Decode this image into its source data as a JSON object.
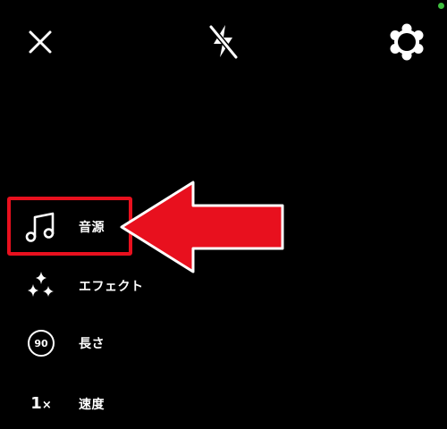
{
  "top_bar": {
    "close_icon": "close-icon",
    "flash_icon": "flash-off-icon",
    "settings_icon": "gear-icon"
  },
  "status_dot_color": "#3fbf3f",
  "menu": {
    "items": [
      {
        "icon": "music-note-icon",
        "label": "音源"
      },
      {
        "icon": "sparkle-icon",
        "label": "エフェクト"
      },
      {
        "icon": "timer-icon",
        "icon_text": "90",
        "label": "長さ"
      },
      {
        "icon": "speed-icon",
        "icon_text": "1",
        "icon_suffix": "×",
        "label": "速度"
      }
    ]
  },
  "annotation": {
    "color": "#e8101e",
    "highlight_target": "音源",
    "arrow_direction": "left"
  }
}
